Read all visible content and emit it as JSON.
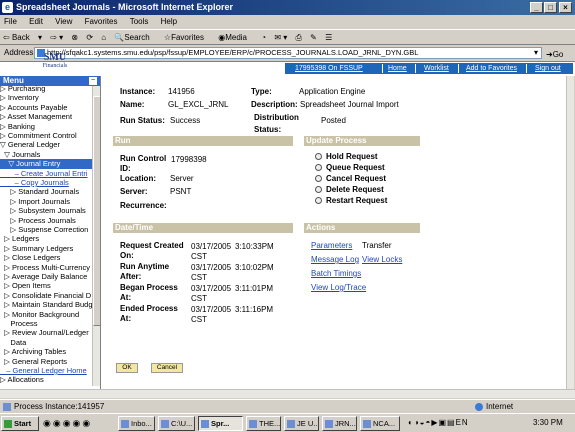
{
  "window": {
    "title": "Spreadsheet Journals - Microsoft Internet Explorer"
  },
  "menubar": [
    "File",
    "Edit",
    "View",
    "Favorites",
    "Tools",
    "Help"
  ],
  "toolbar": {
    "back": "Back",
    "search": "Search",
    "favorites": "Favorites",
    "media": "Media"
  },
  "address": {
    "label": "Address",
    "url": "http://sfqakc1.systems.smu.edu/psp/fssup/EMPLOYEE/ERP/c/PROCESS_JOURNALS.LOAD_JRNL_DYN.GBL",
    "go": "Go"
  },
  "logo": {
    "name": "SMU",
    "sub": "Financials"
  },
  "topnav": [
    "17995398 On FSSUP",
    "Home",
    "Worklist",
    "Add to Favorites",
    "Sign out"
  ],
  "menu": {
    "title": "Menu",
    "items": [
      {
        "label": "▷ Purchasing"
      },
      {
        "label": "▷ Inventory"
      },
      {
        "label": "▷ Accounts Payable"
      },
      {
        "label": "▷ Asset Management"
      },
      {
        "label": "▷ Banking"
      },
      {
        "label": "▷ Commitment Control"
      },
      {
        "label": "▽ General Ledger"
      },
      {
        "label": "  ▽ Journals"
      },
      {
        "label": "    ▽ Journal Entry",
        "style": "sel"
      },
      {
        "label": "       – Create Journal Entri",
        "style": "lnk"
      },
      {
        "label": "       – Copy Journals",
        "style": "lnk"
      },
      {
        "label": "     ▷ Standard Journals"
      },
      {
        "label": "     ▷ Import Journals"
      },
      {
        "label": "     ▷ Subsystem Journals"
      },
      {
        "label": "     ▷ Process Journals"
      },
      {
        "label": "     ▷ Suspense Correction"
      },
      {
        "label": "  ▷ Ledgers"
      },
      {
        "label": "  ▷ Summary Ledgers"
      },
      {
        "label": "  ▷ Close Ledgers"
      },
      {
        "label": "  ▷ Process Multi-Currency"
      },
      {
        "label": "  ▷ Average Daily Balance"
      },
      {
        "label": "  ▷ Open Items"
      },
      {
        "label": "  ▷ Consolidate Financial D"
      },
      {
        "label": "  ▷ Maintain Standard Budg"
      },
      {
        "label": "  ▷ Monitor Background"
      },
      {
        "label": "     Process"
      },
      {
        "label": "  ▷ Review Journal/Ledger"
      },
      {
        "label": "     Data"
      },
      {
        "label": "  ▷ Archiving Tables"
      },
      {
        "label": "  ▷ General Reports"
      },
      {
        "label": "   – General Ledger Home",
        "style": "lnk"
      },
      {
        "label": "▷ Allocations"
      }
    ]
  },
  "details": {
    "instance_label": "Instance:",
    "instance": "141956",
    "type_label": "Type:",
    "type": "Application Engine",
    "name_label": "Name:",
    "name": "GL_EXCL_JRNL",
    "desc_label": "Description:",
    "desc": "Spreadsheet Journal Import",
    "runstatus_label": "Run Status:",
    "runstatus": "Success",
    "dist_label1": "Distribution",
    "dist_label2": "Status:",
    "dist": "Posted"
  },
  "run": {
    "header": "Run",
    "rc_label1": "Run Control",
    "rc_label2": "ID:",
    "rc": "17998398",
    "loc_label": "Location:",
    "loc": "Server",
    "server_label": "Server:",
    "server": "PSNT",
    "rec_label": "Recurrence:"
  },
  "update": {
    "header": "Update Process",
    "options": [
      "Hold Request",
      "Queue Request",
      "Cancel Request",
      "Delete Request",
      "Restart Request"
    ]
  },
  "datetime": {
    "header": "Date/Time",
    "rows": [
      {
        "l1": "Request Created",
        "l2": "On:",
        "d": "03/17/2005",
        "t": "3:10:33PM",
        "tz": "CST"
      },
      {
        "l1": "Run Anytime",
        "l2": "After:",
        "d": "03/17/2005",
        "t": "3:10:02PM",
        "tz": "CST"
      },
      {
        "l1": "Began Process",
        "l2": "At:",
        "d": "03/17/2005",
        "t": "3:11:01PM",
        "tz": "CST"
      },
      {
        "l1": "Ended Process",
        "l2": "At:",
        "d": "03/17/2005",
        "t": "3:11:16PM",
        "tz": "CST"
      }
    ]
  },
  "actions": {
    "header": "Actions",
    "parameters": "Parameters",
    "transfer": "Transfer",
    "messagelog": "Message Log",
    "viewlocks": "View Locks",
    "batchtimings": "Batch Timings",
    "viewlog": "View Log/Trace"
  },
  "buttons": {
    "ok": "OK",
    "cancel": "Cancel"
  },
  "statusbar": {
    "text": "Process Instance:141957",
    "zone": "Internet"
  },
  "taskbar": {
    "start": "Start",
    "tasks": [
      "Inbo...",
      "C:\\U...",
      "Spr...",
      "THE...",
      "JE U...",
      "JRN...",
      "NCA..."
    ],
    "clock": "3:30 PM"
  }
}
